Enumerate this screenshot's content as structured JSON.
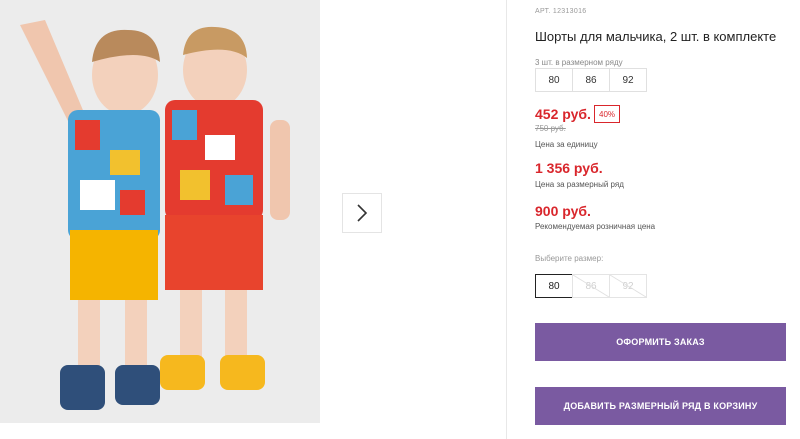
{
  "product": {
    "article": "АРТ. 12313016",
    "title": "Шорты для мальчика, 2 шт. в комплекте",
    "size_row_label": "3 шт. в размерном ряду",
    "size_row": [
      "80",
      "86",
      "92"
    ]
  },
  "prices": {
    "unit_price": "452 руб.",
    "discount": "40%",
    "old_price": "750 руб.",
    "unit_caption": "Цена за единицу",
    "row_price": "1 356 руб.",
    "row_caption": "Цена за размерный ряд",
    "retail_price": "900 руб.",
    "retail_caption": "Рекомендуемая розничная цена"
  },
  "size_select": {
    "label": "Выберите размер:",
    "options": [
      "80",
      "86",
      "92"
    ],
    "selected": "80"
  },
  "actions": {
    "order_label": "ОФОРМИТЬ ЗАКАЗ",
    "add_row_label": "ДОБАВИТЬ РАЗМЕРНЫЙ РЯД В КОРЗИНУ"
  },
  "colors": {
    "accent": "#7a5aa1",
    "price": "#d9262c"
  },
  "icons": {
    "next": "chevron-right-icon"
  }
}
